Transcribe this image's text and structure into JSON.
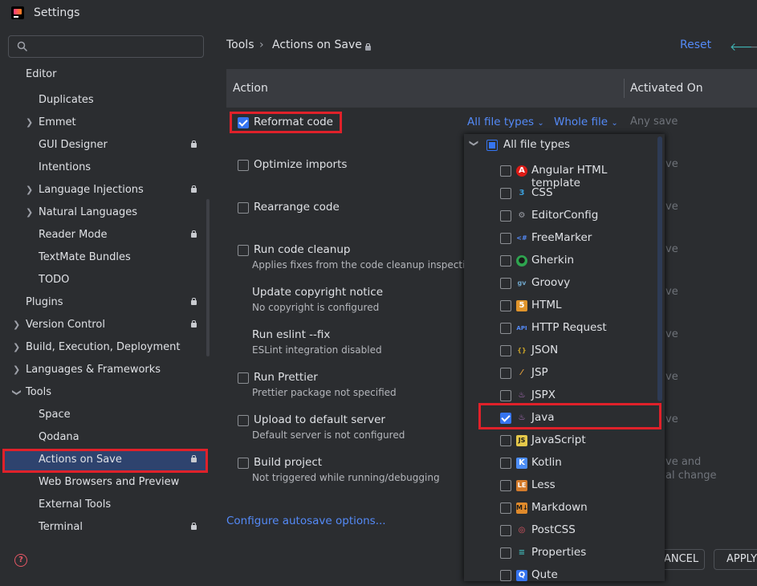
{
  "window": {
    "title": "Settings"
  },
  "search": {
    "placeholder": ""
  },
  "sidebar": {
    "items": [
      {
        "label": "Editor"
      },
      {
        "label": "Duplicates"
      },
      {
        "label": "Emmet"
      },
      {
        "label": "GUI Designer"
      },
      {
        "label": "Intentions"
      },
      {
        "label": "Language Injections"
      },
      {
        "label": "Natural Languages"
      },
      {
        "label": "Reader Mode"
      },
      {
        "label": "TextMate Bundles"
      },
      {
        "label": "TODO"
      },
      {
        "label": "Plugins"
      },
      {
        "label": "Version Control"
      },
      {
        "label": "Build, Execution, Deployment"
      },
      {
        "label": "Languages & Frameworks"
      },
      {
        "label": "Tools"
      },
      {
        "label": "Space"
      },
      {
        "label": "Qodana"
      },
      {
        "label": "Actions on Save"
      },
      {
        "label": "Web Browsers and Preview"
      },
      {
        "label": "External Tools"
      },
      {
        "label": "Terminal"
      }
    ]
  },
  "breadcrumb": {
    "parent": "Tools",
    "separator": "›",
    "current": "Actions on Save"
  },
  "header": {
    "reset_label": "Reset"
  },
  "table": {
    "col_action": "Action",
    "col_activated": "Activated On"
  },
  "actions": [
    {
      "title": "Reformat code",
      "subtitle": "",
      "checked": true
    },
    {
      "title": "Optimize imports",
      "subtitle": "",
      "checked": false
    },
    {
      "title": "Rearrange code",
      "subtitle": "",
      "checked": false
    },
    {
      "title": "Run code cleanup",
      "subtitle": "Applies fixes from the code cleanup inspections",
      "checked": false
    },
    {
      "title": "Update copyright notice",
      "subtitle": "No copyright is configured",
      "checked": false
    },
    {
      "title": "Run eslint --fix",
      "subtitle": "ESLint integration disabled",
      "checked": false
    },
    {
      "title": "Run Prettier",
      "subtitle": "Prettier package not specified",
      "checked": false
    },
    {
      "title": "Upload to default server",
      "subtitle": "Default server is not configured",
      "checked": false
    },
    {
      "title": "Build project",
      "subtitle": "Not triggered while running/debugging",
      "checked": false
    }
  ],
  "reformat": {
    "file_types": "All file types",
    "scope": "Whole file",
    "activated": "Any save"
  },
  "activated_partials": [
    "ve",
    "ve",
    "ve",
    "ve",
    "ve",
    "ve",
    "ve",
    "ve and",
    "al change"
  ],
  "configure_link": "Configure autosave options...",
  "popup": {
    "root_label": "All file types",
    "items": [
      {
        "label": "Angular HTML template",
        "icon": "angular-icon",
        "checked": false
      },
      {
        "label": "CSS",
        "icon": "css-icon",
        "checked": false
      },
      {
        "label": "EditorConfig",
        "icon": "editorconfig-icon",
        "checked": false
      },
      {
        "label": "FreeMarker",
        "icon": "freemarker-icon",
        "checked": false
      },
      {
        "label": "Gherkin",
        "icon": "gherkin-icon",
        "checked": false
      },
      {
        "label": "Groovy",
        "icon": "groovy-icon",
        "checked": false
      },
      {
        "label": "HTML",
        "icon": "html-icon",
        "checked": false
      },
      {
        "label": "HTTP Request",
        "icon": "http-request-icon",
        "checked": false
      },
      {
        "label": "JSON",
        "icon": "json-icon",
        "checked": false
      },
      {
        "label": "JSP",
        "icon": "jsp-icon",
        "checked": false
      },
      {
        "label": "JSPX",
        "icon": "jspx-icon",
        "checked": false
      },
      {
        "label": "Java",
        "icon": "java-icon",
        "checked": true
      },
      {
        "label": "JavaScript",
        "icon": "javascript-icon",
        "checked": false
      },
      {
        "label": "Kotlin",
        "icon": "kotlin-icon",
        "checked": false
      },
      {
        "label": "Less",
        "icon": "less-icon",
        "checked": false
      },
      {
        "label": "Markdown",
        "icon": "markdown-icon",
        "checked": false
      },
      {
        "label": "PostCSS",
        "icon": "postcss-icon",
        "checked": false
      },
      {
        "label": "Properties",
        "icon": "properties-icon",
        "checked": false
      },
      {
        "label": "Qute",
        "icon": "qute-icon",
        "checked": false
      }
    ]
  },
  "footer": {
    "cancel_label": "CANCEL",
    "apply_label": "APPLY"
  },
  "colors": {
    "accent": "#3574f0",
    "link": "#548af7",
    "highlight_box": "#e0212a",
    "selection": "#2e436e"
  }
}
